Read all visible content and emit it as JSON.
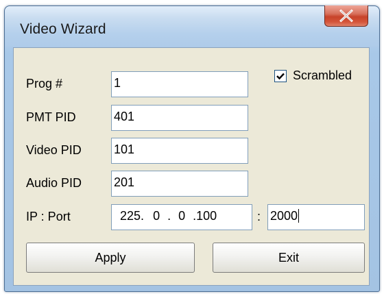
{
  "window": {
    "title": "Video Wizard",
    "close_symbol": "close-icon"
  },
  "form": {
    "prog": {
      "label": "Prog #",
      "value": "1"
    },
    "pmt_pid": {
      "label": "PMT PID",
      "value": "401"
    },
    "video_pid": {
      "label": "Video PID",
      "value": "101"
    },
    "audio_pid": {
      "label": "Audio PID",
      "value": "201"
    },
    "ip_port": {
      "label": "IP : Port",
      "ip_octets": [
        "225.",
        "0",
        ".",
        "0",
        ".100"
      ],
      "separator": ":",
      "port": "2000"
    },
    "scrambled": {
      "label": "Scrambled",
      "checked": true
    }
  },
  "buttons": {
    "apply": "Apply",
    "exit": "Exit"
  },
  "colors": {
    "title_bar": "#b6d2ee",
    "close_button": "#c7432a",
    "dialog_face": "#ece9d8",
    "field_border": "#7f9db9"
  }
}
